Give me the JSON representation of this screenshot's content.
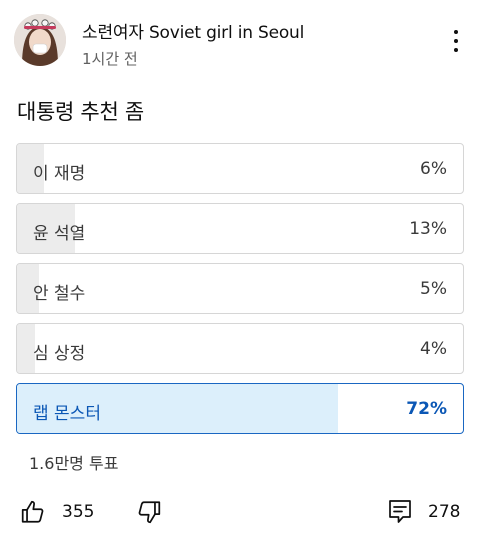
{
  "post": {
    "channel_name": "소련여자 Soviet girl in Seoul",
    "time": "1시간 전",
    "menu_icon": "more-vert-icon"
  },
  "poll": {
    "question": "대통령 추천 좀",
    "options": [
      {
        "label": "이 재명",
        "percent_text": "6%",
        "percent": 6,
        "selected": false
      },
      {
        "label": "윤 석열",
        "percent_text": "13%",
        "percent": 13,
        "selected": false
      },
      {
        "label": "안 철수",
        "percent_text": "5%",
        "percent": 5,
        "selected": false
      },
      {
        "label": "심 상정",
        "percent_text": "4%",
        "percent": 4,
        "selected": false
      },
      {
        "label": "랩 몬스터",
        "percent_text": "72%",
        "percent": 72,
        "selected": true
      }
    ],
    "votes_text": "1.6만명 투표"
  },
  "actions": {
    "like_count": "355",
    "comment_count": "278",
    "like_icon": "thumbs-up-icon",
    "dislike_icon": "thumbs-down-icon",
    "comment_icon": "comment-icon"
  },
  "colors": {
    "selected_border": "#1a67c2",
    "selected_fill": "#dceffb",
    "unselected_fill": "#ececec"
  }
}
